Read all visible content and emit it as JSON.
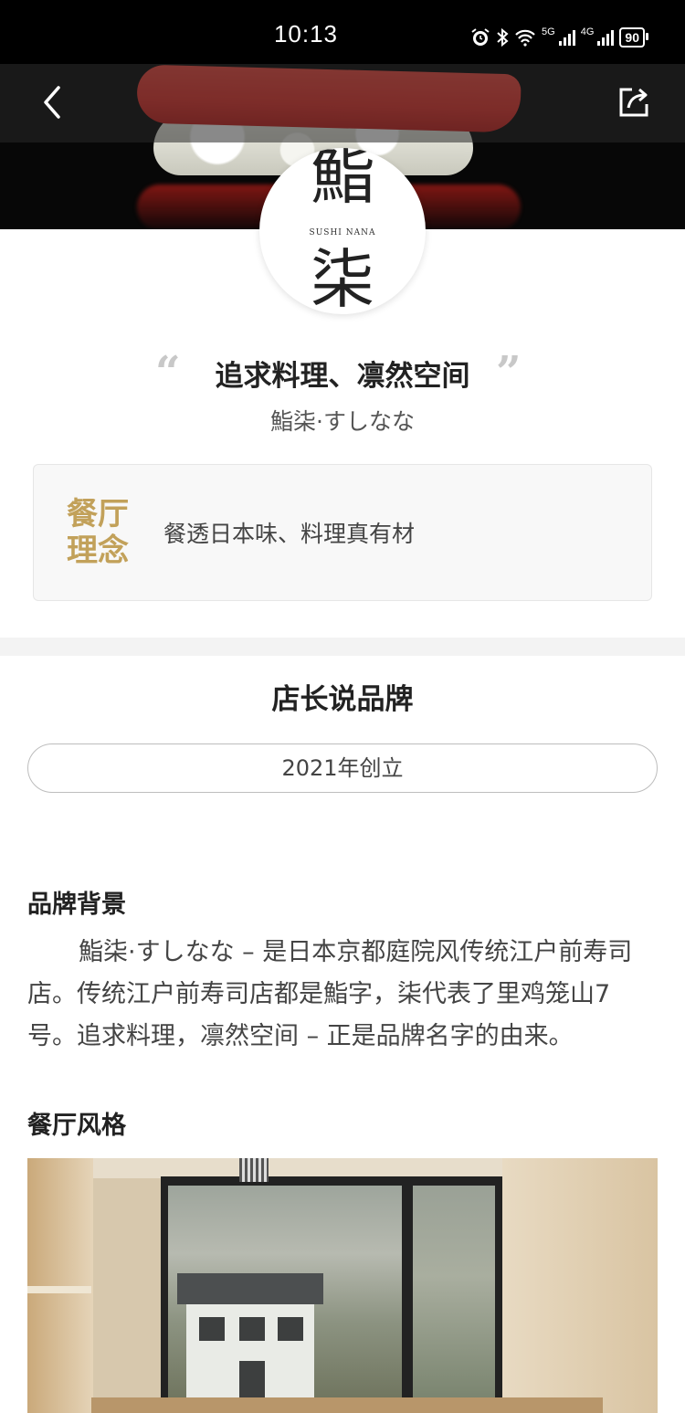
{
  "status_bar": {
    "time": "10:13",
    "network_1": "5G",
    "network_2": "4G",
    "battery": "90"
  },
  "header": {
    "back_icon": "chevron-left-icon",
    "share_icon": "share-icon"
  },
  "logo": {
    "char_top": "鮨",
    "char_bottom": "柒",
    "english": "SUSHI NANA"
  },
  "slogan": {
    "text": "追求料理、凛然空间",
    "open_quote": "“",
    "close_quote": "”"
  },
  "brand_name": "鮨柒·すしなな",
  "philosophy": {
    "label_line1": "餐厅",
    "label_line2": "理念",
    "text": "餐透日本味、料理真有材",
    "label_color": "#c2a15a"
  },
  "brand_section": {
    "title": "店长说品牌",
    "founded": "2021年创立",
    "background_heading": "品牌背景",
    "background_text": "鮨柒·すしなな – 是日本京都庭院风传统江户前寿司店。传统江户前寿司店都是鮨字，柒代表了里鸡笼山7号。追求料理，凛然空间 – 正是品牌名字的由来。",
    "style_heading": "餐厅风格"
  }
}
